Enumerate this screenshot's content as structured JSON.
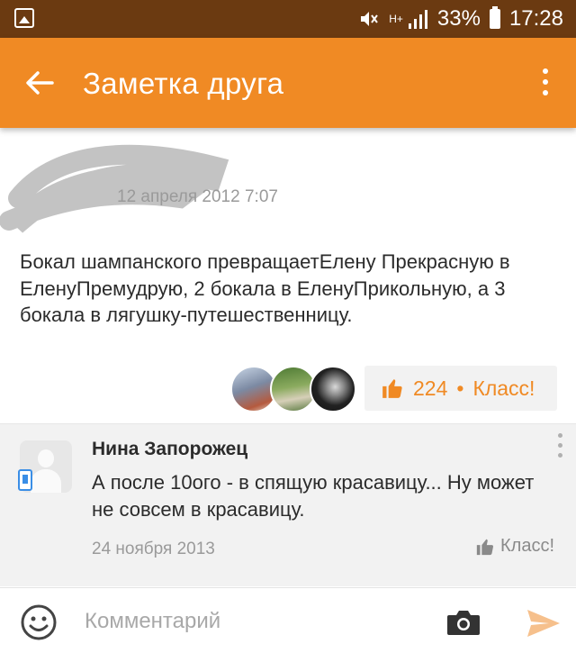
{
  "status_bar": {
    "battery": "33%",
    "time": "17:28",
    "network": "H+"
  },
  "app_bar": {
    "title": "Заметка друга"
  },
  "post": {
    "date": "12 апреля 2012 7:07",
    "text": "Бокал шампанского превращаетЕлену Прекрасную в ЕленуПремудрую, 2 бокала в ЕленуПрикольную, а 3 бокала в лягушку-путешественницу.",
    "klass_count": "224",
    "klass_separator": "•",
    "klass_label": "Класс!"
  },
  "comment": {
    "author": "Нина Запорожец",
    "text": "А после 10ого - в спящую красавицу... Ну может не совсем в красавицу.",
    "date": "24 ноября 2013",
    "klass_label": "Класс!"
  },
  "input_bar": {
    "placeholder": "Комментарий"
  },
  "colors": {
    "accent": "#f08a24",
    "status_bar": "#6b3a11",
    "badge_blue": "#3a8ee6"
  },
  "icons": [
    "gallery-icon",
    "mute-icon",
    "signal-icon",
    "battery-icon",
    "back-arrow-icon",
    "overflow-menu-icon",
    "thumbs-up-icon",
    "smiley-icon",
    "camera-icon",
    "send-icon"
  ]
}
